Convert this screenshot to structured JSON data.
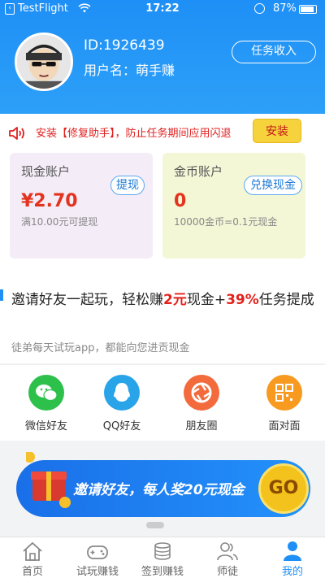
{
  "status_bar": {
    "app": "TestFlight",
    "time": "17:22",
    "battery": "87%"
  },
  "profile": {
    "id": "ID:1926439",
    "username": "用户名：萌手赚",
    "task_income_label": "任务收入"
  },
  "notice": {
    "text": "安装【修复助手】，防止任务期间应用闪退",
    "install_label": "安装"
  },
  "accounts": {
    "cash": {
      "title": "现金账户",
      "button": "提现",
      "amount": "¥2.70",
      "sub": "满10.00元可提现"
    },
    "coin": {
      "title": "金币账户",
      "button": "兑换现金",
      "amount": "0",
      "sub": "10000金币=0.1元现金"
    }
  },
  "invite": {
    "title_a": "邀请好友一起玩，轻松赚",
    "title_b": "2元",
    "title_c": "现金+",
    "title_d": "39%",
    "title_e": "任务提成",
    "desc": "徒弟每天试玩app，都能向您进贡现金"
  },
  "share": [
    {
      "label": "微信好友",
      "icon": "wechat-icon",
      "color": "#2dc14b"
    },
    {
      "label": "QQ好友",
      "icon": "qq-icon",
      "color": "#2aa4e8"
    },
    {
      "label": "朋友圈",
      "icon": "moments-icon",
      "color": "#f36a3c"
    },
    {
      "label": "面对面",
      "icon": "qrcode-icon",
      "color": "#f79a1f"
    }
  ],
  "banner": {
    "text": "邀请好友，每人奖20元现金",
    "go": "GO"
  },
  "tabs": [
    {
      "label": "首页",
      "icon": "home-icon"
    },
    {
      "label": "试玩赚钱",
      "icon": "gamepad-icon"
    },
    {
      "label": "签到赚钱",
      "icon": "coins-icon"
    },
    {
      "label": "师徒",
      "icon": "people-icon"
    },
    {
      "label": "我的",
      "icon": "person-icon",
      "active": true
    }
  ],
  "colors": {
    "primary": "#1e8ff6",
    "accent_red": "#e3331e",
    "install_bg": "#f6d23c"
  }
}
